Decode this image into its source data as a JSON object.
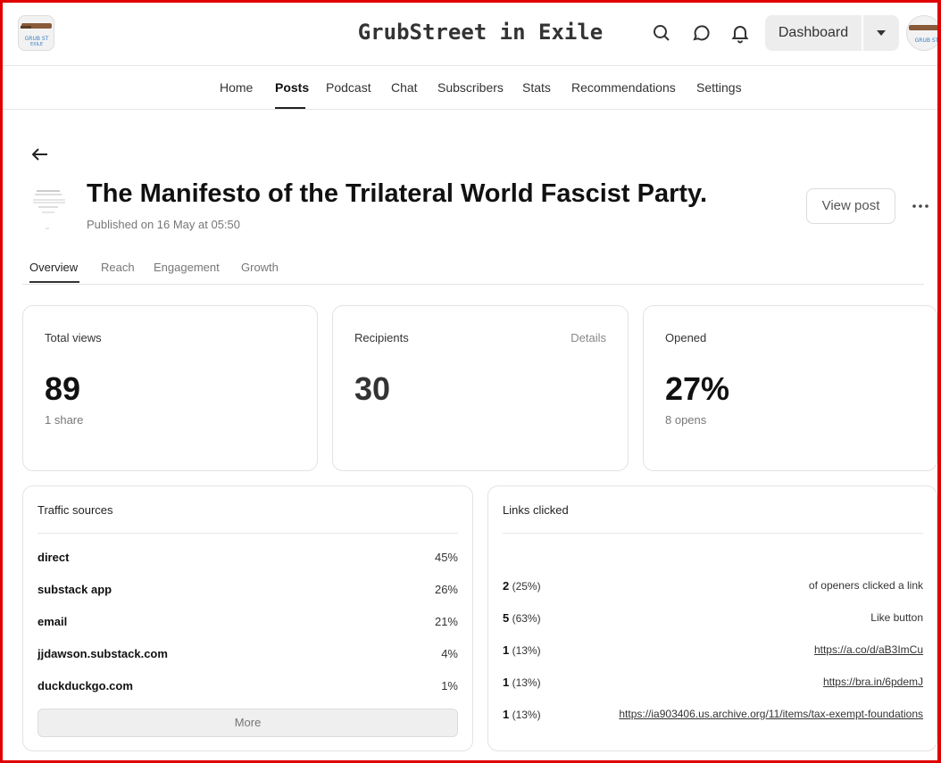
{
  "header": {
    "site_title": "GrubStreet in Exile",
    "dashboard_label": "Dashboard",
    "icons": [
      "search-icon",
      "chat-bubble-icon",
      "bell-icon",
      "caret-down-icon"
    ]
  },
  "nav": {
    "items": [
      "Home",
      "Posts",
      "Podcast",
      "Chat",
      "Subscribers",
      "Stats",
      "Recommendations",
      "Settings"
    ],
    "active": "Posts"
  },
  "post": {
    "title": "The Manifesto of the Trilateral World Fascist Party.",
    "published": "Published on 16 May at 05:50",
    "view_post_label": "View post"
  },
  "subtabs": {
    "items": [
      "Overview",
      "Reach",
      "Engagement",
      "Growth"
    ],
    "active": "Overview"
  },
  "stats": {
    "total_views": {
      "label": "Total views",
      "value": "89",
      "sub": "1 share"
    },
    "recipients": {
      "label": "Recipients",
      "value": "30",
      "details": "Details"
    },
    "opened": {
      "label": "Opened",
      "value": "27%",
      "sub": "8 opens"
    }
  },
  "traffic": {
    "title": "Traffic sources",
    "rows": [
      {
        "source": "direct",
        "pct": "45%"
      },
      {
        "source": "substack app",
        "pct": "26%"
      },
      {
        "source": "email",
        "pct": "21%"
      },
      {
        "source": "jjdawson.substack.com",
        "pct": "4%"
      },
      {
        "source": "duckduckgo.com",
        "pct": "1%"
      }
    ],
    "more_label": "More"
  },
  "links": {
    "title": "Links clicked",
    "rows": [
      {
        "count": "2",
        "pct": "(25%)",
        "target": "of openers clicked a link"
      },
      {
        "count": "5",
        "pct": "(63%)",
        "target": "Like button"
      },
      {
        "count": "1",
        "pct": "(13%)",
        "target": "https://a.co/d/aB3ImCu"
      },
      {
        "count": "1",
        "pct": "(13%)",
        "target": "https://bra.in/6pdemJ"
      },
      {
        "count": "1",
        "pct": "(13%)",
        "target": "https://ia903406.us.archive.org/11/items/tax-exempt-foundations"
      }
    ]
  },
  "colors": {
    "frame": "#e00000",
    "active_underline": "#222222"
  }
}
